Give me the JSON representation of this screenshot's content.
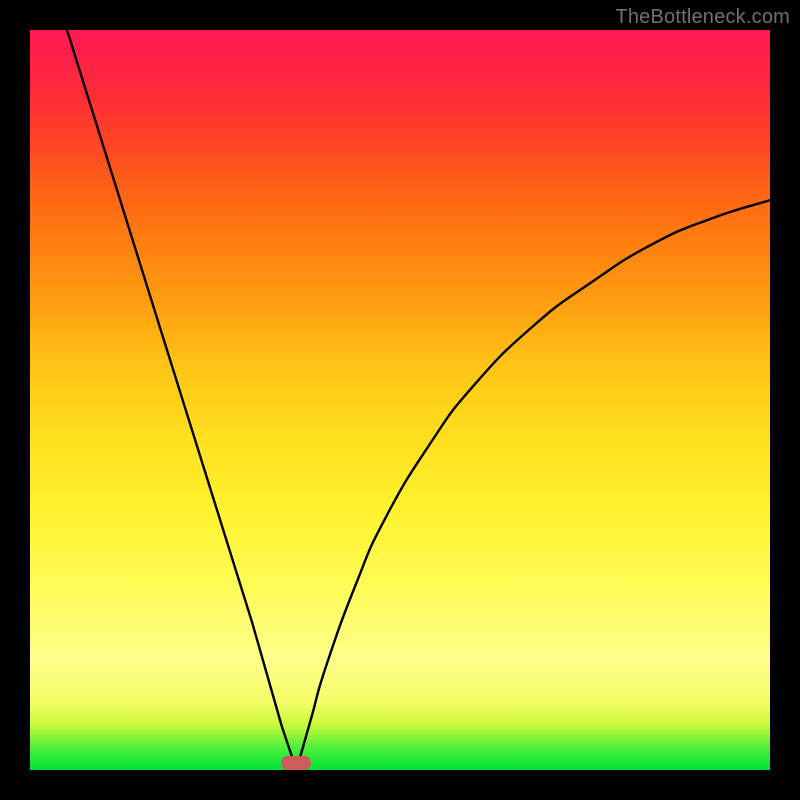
{
  "watermark": "TheBottleneck.com",
  "colors": {
    "frame": "#000000",
    "curve": "#000000",
    "marker": "#cd5c5c"
  },
  "chart_data": {
    "type": "line",
    "title": "",
    "xlabel": "",
    "ylabel": "",
    "xlim": [
      0,
      100
    ],
    "ylim": [
      0,
      100
    ],
    "grid": false,
    "description": "V-shaped bottleneck curve over red-to-green gradient; minimum (optimal point) marked by pill.",
    "optimum_x": 36,
    "series": [
      {
        "name": "left-branch",
        "x": [
          5,
          10,
          15,
          20,
          25,
          30,
          34,
          36
        ],
        "values": [
          100,
          84,
          68,
          52,
          36,
          20,
          6,
          0
        ]
      },
      {
        "name": "right-branch",
        "x": [
          36,
          38,
          40,
          44,
          48,
          54,
          60,
          68,
          76,
          84,
          92,
          100
        ],
        "values": [
          0,
          7,
          14,
          25,
          34,
          44,
          52,
          60,
          66,
          71,
          74.5,
          77
        ]
      }
    ],
    "marker": {
      "x": 36,
      "y": 1
    }
  }
}
